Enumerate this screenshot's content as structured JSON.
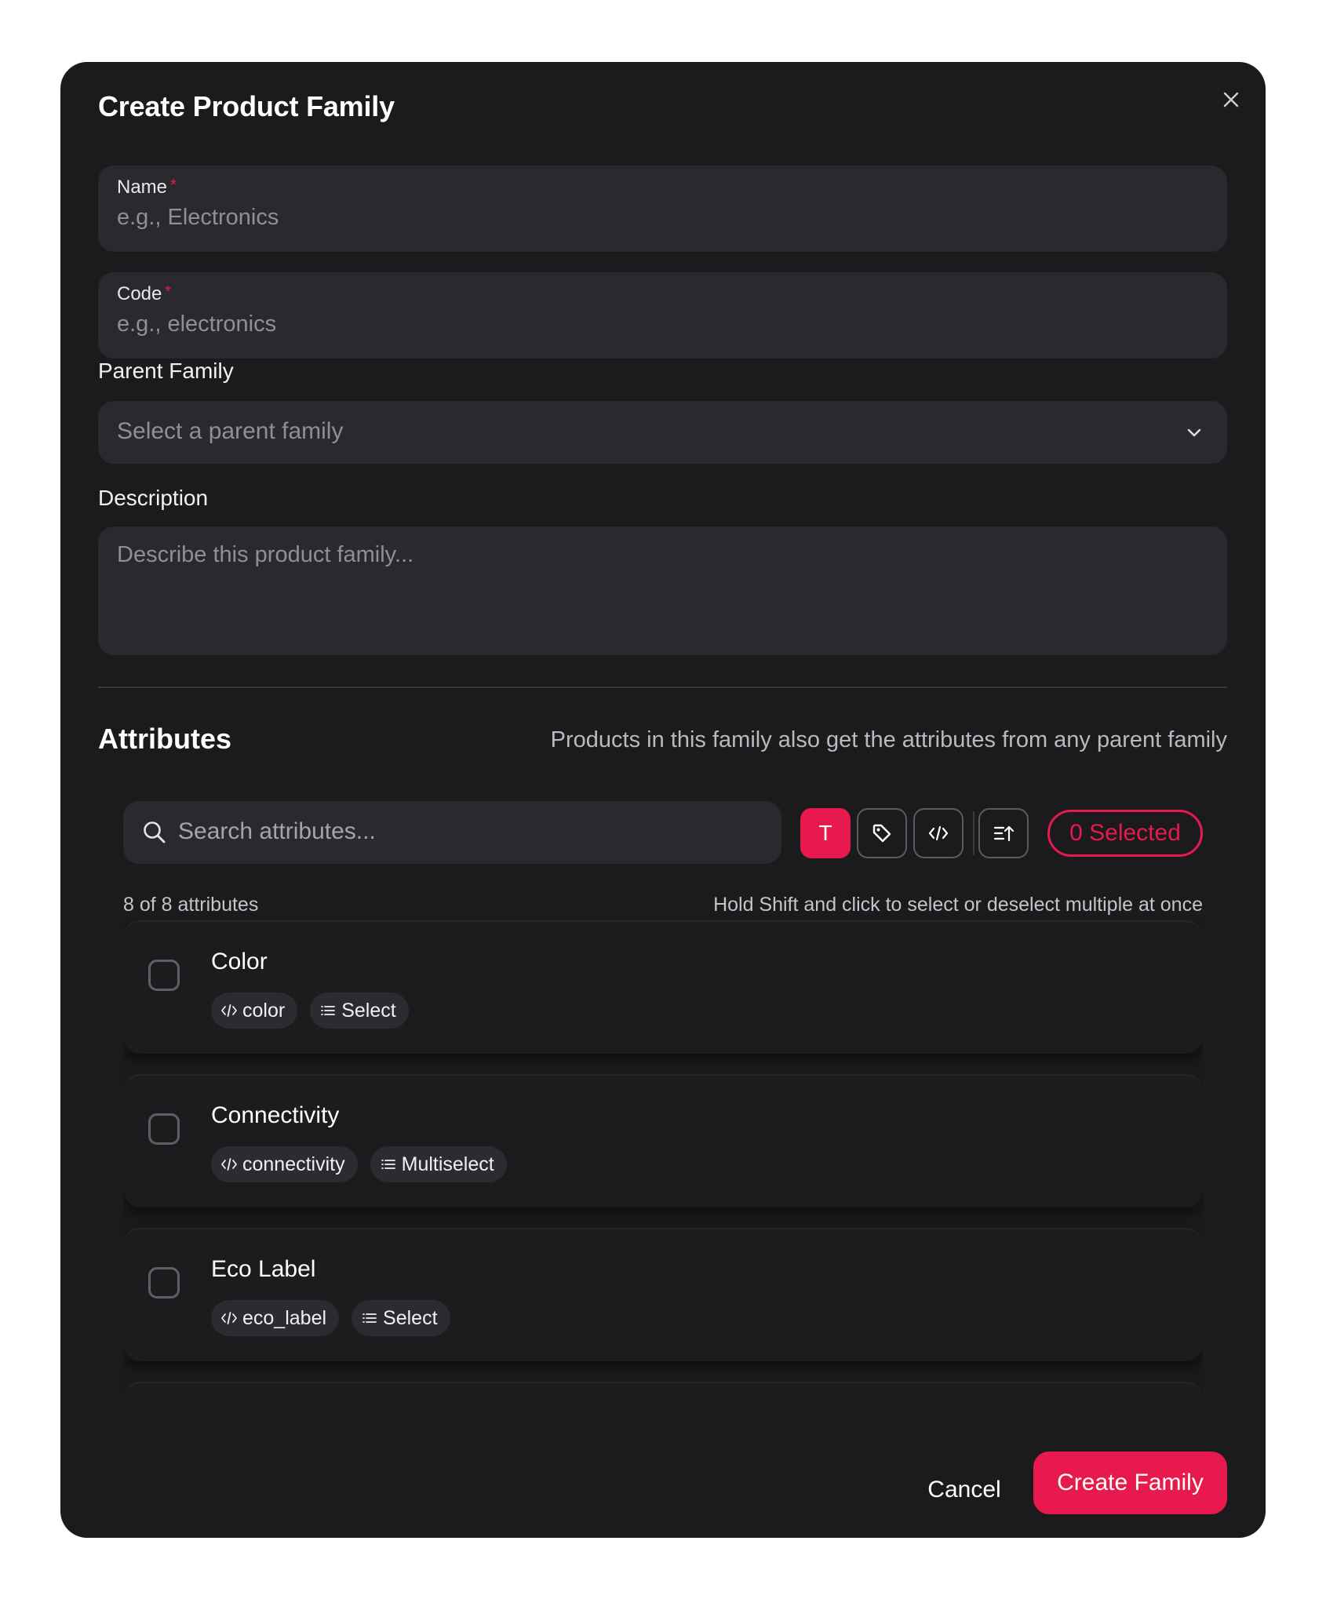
{
  "modal": {
    "title": "Create Product Family",
    "close_icon": "close-icon"
  },
  "form": {
    "name": {
      "label": "Name",
      "required_mark": "*",
      "placeholder": "e.g., Electronics",
      "value": ""
    },
    "code": {
      "label": "Code",
      "required_mark": "*",
      "placeholder": "e.g., electronics",
      "value": ""
    },
    "parent_family": {
      "label": "Parent Family",
      "placeholder": "Select a parent family",
      "icon": "chevron-down-icon"
    },
    "description": {
      "label": "Description",
      "placeholder": "Describe this product family..."
    }
  },
  "attributes": {
    "title": "Attributes",
    "note": "Products in this family also get the attributes from any parent family",
    "search_placeholder": "Search attributes...",
    "toolbar": {
      "type_filter_label": "T",
      "tag_icon": "tag-icon",
      "code_icon": "code-icon",
      "sort_icon": "sort-icon",
      "selected_label": "0 Selected"
    },
    "count_text": "8 of 8 attributes",
    "hint_text": "Hold Shift and click to select or deselect multiple at once",
    "items": [
      {
        "name": "Color",
        "code": "color",
        "type": "Select",
        "checked": false
      },
      {
        "name": "Connectivity",
        "code": "connectivity",
        "type": "Multiselect",
        "checked": false
      },
      {
        "name": "Eco Label",
        "code": "eco_label",
        "type": "Select",
        "checked": false
      }
    ]
  },
  "footer": {
    "cancel_label": "Cancel",
    "create_label": "Create Family"
  },
  "colors": {
    "accent": "#e8194c",
    "modal_bg": "#1b1b1e",
    "field_bg": "#2a2a2e"
  }
}
